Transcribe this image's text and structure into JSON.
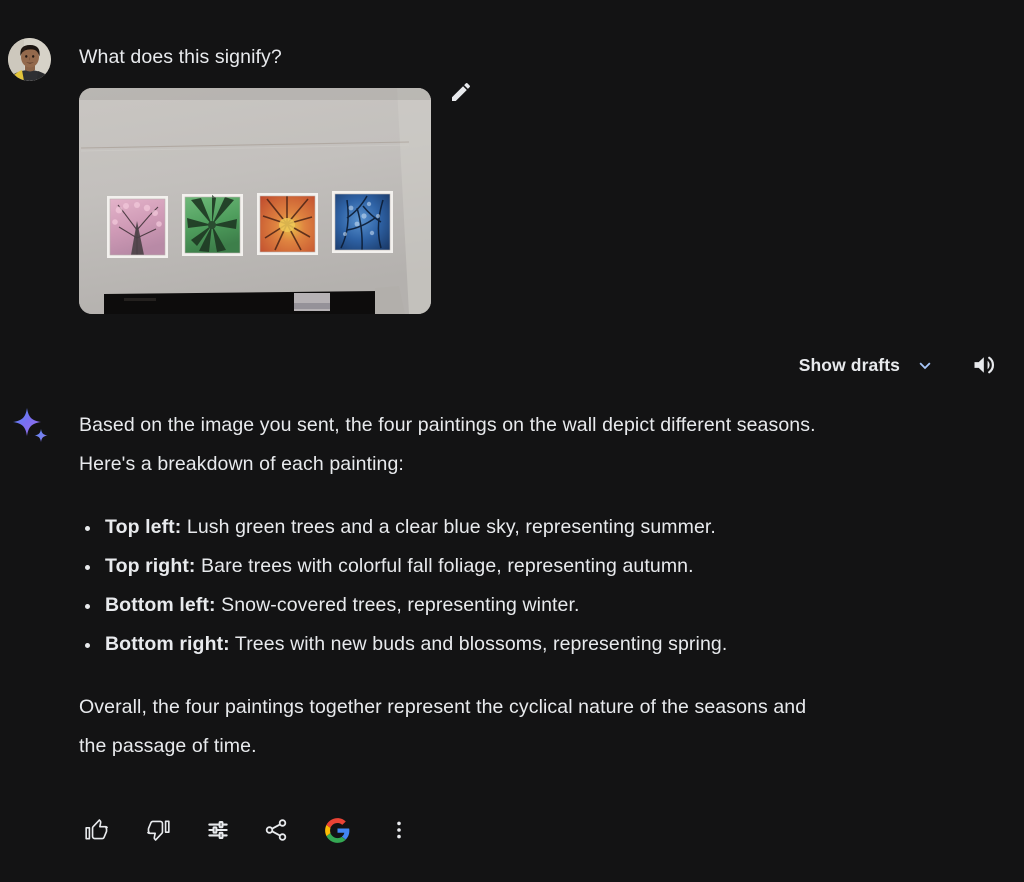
{
  "theme": {
    "background": "#131314",
    "text_primary": "#e8eaed",
    "accent_blue": "#4285F4",
    "google_red": "#EA4335",
    "google_yellow": "#FBBC05",
    "google_green": "#34A853"
  },
  "prompt": {
    "text": "What does this signify?",
    "avatar_name": "user-avatar",
    "edit_icon": "pencil-icon",
    "edit_label": "Edit prompt"
  },
  "attachment": {
    "name": "uploaded-photo",
    "alt": "Four framed paintings of trees in different seasons hanging on a white wall",
    "paintings": [
      {
        "season": "spring",
        "description": "Pink cherry blossom tree with dark trunk silhouette",
        "color": "#d9a6bd"
      },
      {
        "season": "summer",
        "description": "Green canopy of leaves seen from below",
        "color": "#5aa364"
      },
      {
        "season": "autumn",
        "description": "Orange and red fall foliage canopy",
        "color": "#d4603a"
      },
      {
        "season": "winter",
        "description": "Blue snow-covered bare branches",
        "color": "#2a5f9e"
      }
    ]
  },
  "drafts": {
    "label": "Show drafts",
    "chevron_icon": "chevron-down-icon",
    "speaker_icon": "speaker-icon",
    "speaker_label": "Read aloud"
  },
  "response": {
    "gemini_icon": "gemini-sparkle-icon",
    "intro_line_1": "Based on the image you sent, the four paintings on the wall depict different seasons.",
    "intro_line_2": "Here's a breakdown of each painting:",
    "bullets": [
      {
        "label": "Top left:",
        "text": " Lush green trees and a clear blue sky, representing summer."
      },
      {
        "label": "Top right:",
        "text": " Bare trees with colorful fall foliage, representing autumn."
      },
      {
        "label": "Bottom left:",
        "text": " Snow-covered trees, representing winter."
      },
      {
        "label": "Bottom right:",
        "text": " Trees with new buds and blossoms, representing spring."
      }
    ],
    "outro_line_1": "Overall, the four paintings together represent the cyclical nature of the seasons and",
    "outro_line_2": "the passage of time."
  },
  "actions": [
    {
      "name": "thumb-up-icon",
      "label": "Good response"
    },
    {
      "name": "thumb-down-icon",
      "label": "Bad response"
    },
    {
      "name": "tune-icon",
      "label": "Modify response"
    },
    {
      "name": "share-icon",
      "label": "Share & export"
    },
    {
      "name": "google-search-icon",
      "label": "Google it"
    },
    {
      "name": "more-vert-icon",
      "label": "More"
    }
  ]
}
